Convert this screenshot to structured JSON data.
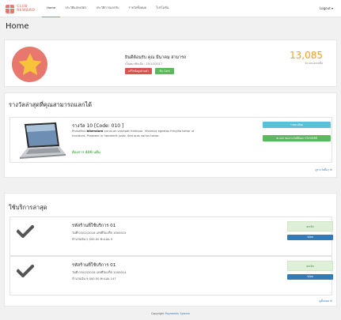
{
  "brand": {
    "line1": "CLUB",
    "line2": "REWARD",
    "color": "#e8786e"
  },
  "nav": {
    "items": [
      {
        "label": "Home",
        "active": true
      },
      {
        "label": "ประวัติแสดงบัตร"
      },
      {
        "label": "ประวัติการแลกรับ"
      },
      {
        "label": "รายวัลทั้งหมด"
      },
      {
        "label": "โปรโมชั่น"
      }
    ],
    "logout": "Logout ▾"
  },
  "page_title": "Home",
  "profile": {
    "name": "ยินดีต้อนรับ คุณ มีนาคม สามารถ",
    "member_since": "เป็นสมาชิกเมื่อ : 25/10/2017",
    "edit_label": "แก้ไขข้อมูลส่วนตัว",
    "card_label": "My Card",
    "points": "13,085",
    "points_label": "คะแนนคงเหลือ"
  },
  "rewards": {
    "title": "รางวัลล่าสุดที่คุณสามารถแลกได้",
    "items": [
      {
        "title": "รางวัล 10 [Code: 010 ]",
        "desc_bold": "bibendum",
        "desc_pre": "Phasellus ",
        "desc_post": " purus ac volutpat tristique. Vivamus egestas fringilla tortor ut tincidunt. Praesent in hendrerit justo. Sed quis varius tortor.",
        "need": "ต้องการ 400 แต้ม",
        "detail_label": "รายละเอียด",
        "redeem_label": "⊞ แลก ของรางวัลที่ต้องการไปรับได้ที่"
      }
    ],
    "more": "ดูรางวัลอื่นๆ ⊕"
  },
  "services": {
    "title": "ใช้บริการล่าสุด",
    "items": [
      {
        "title": "รหัสร้านที่ใช้บริการ 01",
        "line1": "วันที่ 03/02/2018 เลขที่ใบเสร็จ 1000015",
        "line2": "จำนวนเงิน 2,500.00 คะแนน 5",
        "status": "ยกเลิก",
        "view_label": "View"
      },
      {
        "title": "รหัสร้านที่ใช้บริการ 01",
        "line1": "วันที่ 03/02/2018 เลขที่ใบเสร็จ 1000014",
        "line2": "จำนวนเงิน 9,500.00 คะแนน 147",
        "status": "ยกเลิก",
        "view_label": "View"
      }
    ],
    "more": "ดูทั้งหมด ⊕"
  },
  "footer": {
    "text": "Copyright ",
    "link": "Paymentic System"
  },
  "icons": {
    "avatar": "star-icon",
    "service": "check-icon",
    "reward_image": "laptop-image"
  },
  "colors": {
    "accent": "#e8786e",
    "points": "#f0a020",
    "success": "#5cb85c",
    "info": "#5bc0de",
    "danger": "#d9534f",
    "primary": "#337ab7"
  }
}
